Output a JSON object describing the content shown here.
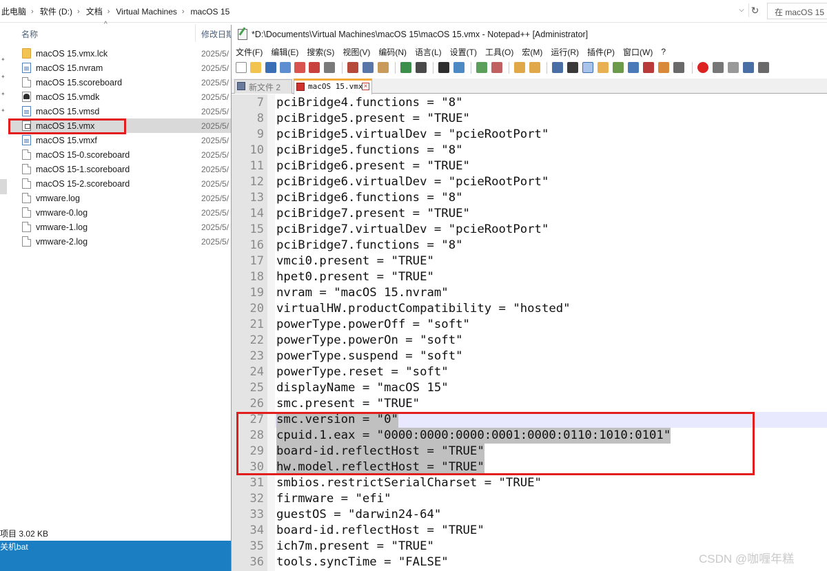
{
  "address_bar": {
    "breadcrumbs": [
      "此电脑",
      "软件 (D:)",
      "文档",
      "Virtual Machines",
      "macOS 15"
    ],
    "search_placeholder": "在 macOS 15"
  },
  "explorer": {
    "columns": {
      "name": "名称",
      "date": "修改日期"
    },
    "files": [
      {
        "name": "macOS 15.vmx.lck",
        "date": "2025/5/",
        "icon": "folder-icon"
      },
      {
        "name": "macOS 15.nvram",
        "date": "2025/5/",
        "icon": "document-blue-icon"
      },
      {
        "name": "macOS 15.scoreboard",
        "date": "2025/5/",
        "icon": "document-icon"
      },
      {
        "name": "macOS 15.vmdk",
        "date": "2025/5/",
        "icon": "disk-image-icon"
      },
      {
        "name": "macOS 15.vmsd",
        "date": "2025/5/",
        "icon": "document-blue-icon"
      },
      {
        "name": "macOS 15.vmx",
        "date": "2025/5/",
        "icon": "vm-config-icon",
        "selected": true
      },
      {
        "name": "macOS 15.vmxf",
        "date": "2025/5/",
        "icon": "document-blue-icon"
      },
      {
        "name": "macOS 15-0.scoreboard",
        "date": "2025/5/",
        "icon": "document-icon"
      },
      {
        "name": "macOS 15-1.scoreboard",
        "date": "2025/5/",
        "icon": "document-icon"
      },
      {
        "name": "macOS 15-2.scoreboard",
        "date": "2025/5/",
        "icon": "document-icon"
      },
      {
        "name": "vmware.log",
        "date": "2025/5/",
        "icon": "document-icon"
      },
      {
        "name": "vmware-0.log",
        "date": "2025/5/",
        "icon": "document-icon"
      },
      {
        "name": "vmware-1.log",
        "date": "2025/5/",
        "icon": "document-icon"
      },
      {
        "name": "vmware-2.log",
        "date": "2025/5/",
        "icon": "document-icon"
      }
    ],
    "status_text": "项目  3.02 KB",
    "taskbar_text": "关机bat"
  },
  "notepadpp": {
    "title": "*D:\\Documents\\Virtual Machines\\macOS 15\\macOS 15.vmx - Notepad++ [Administrator]",
    "menu": [
      "文件(F)",
      "编辑(E)",
      "搜索(S)",
      "视图(V)",
      "编码(N)",
      "语言(L)",
      "设置(T)",
      "工具(O)",
      "宏(M)",
      "运行(R)",
      "插件(P)",
      "窗口(W)",
      "?"
    ],
    "tabs": [
      {
        "label": "新文件 2",
        "active": false
      },
      {
        "label": "macOS 15.vmx",
        "active": true
      }
    ],
    "current_line": 27,
    "lines": [
      {
        "n": "7",
        "text": "pciBridge4.functions = \"8\""
      },
      {
        "n": "8",
        "text": "pciBridge5.present = \"TRUE\""
      },
      {
        "n": "9",
        "text": "pciBridge5.virtualDev = \"pcieRootPort\""
      },
      {
        "n": "10",
        "text": "pciBridge5.functions = \"8\""
      },
      {
        "n": "11",
        "text": "pciBridge6.present = \"TRUE\""
      },
      {
        "n": "12",
        "text": "pciBridge6.virtualDev = \"pcieRootPort\""
      },
      {
        "n": "13",
        "text": "pciBridge6.functions = \"8\""
      },
      {
        "n": "14",
        "text": "pciBridge7.present = \"TRUE\""
      },
      {
        "n": "15",
        "text": "pciBridge7.virtualDev = \"pcieRootPort\""
      },
      {
        "n": "16",
        "text": "pciBridge7.functions = \"8\""
      },
      {
        "n": "17",
        "text": "vmci0.present = \"TRUE\""
      },
      {
        "n": "18",
        "text": "hpet0.present = \"TRUE\""
      },
      {
        "n": "19",
        "text": "nvram = \"macOS 15.nvram\""
      },
      {
        "n": "20",
        "text": "virtualHW.productCompatibility = \"hosted\""
      },
      {
        "n": "21",
        "text": "powerType.powerOff = \"soft\""
      },
      {
        "n": "22",
        "text": "powerType.powerOn = \"soft\""
      },
      {
        "n": "23",
        "text": "powerType.suspend = \"soft\""
      },
      {
        "n": "24",
        "text": "powerType.reset = \"soft\""
      },
      {
        "n": "25",
        "text": "displayName = \"macOS 15\""
      },
      {
        "n": "26",
        "text": "smc.present = \"TRUE\""
      },
      {
        "n": "27",
        "text": "smc.version = \"0\"",
        "selected": true
      },
      {
        "n": "28",
        "text": "cpuid.1.eax = \"0000:0000:0000:0001:0000:0110:1010:0101\"",
        "selected": true
      },
      {
        "n": "29",
        "text": "board-id.reflectHost = \"TRUE\"",
        "selected": true
      },
      {
        "n": "30",
        "text": "hw.model.reflectHost = \"TRUE\"",
        "selected": true
      },
      {
        "n": "31",
        "text": "smbios.restrictSerialCharset = \"TRUE\""
      },
      {
        "n": "32",
        "text": "firmware = \"efi\""
      },
      {
        "n": "33",
        "text": "guestOS = \"darwin24-64\""
      },
      {
        "n": "34",
        "text": "board-id.reflectHost = \"TRUE\""
      },
      {
        "n": "35",
        "text": "ich7m.present = \"TRUE\""
      },
      {
        "n": "36",
        "text": "tools.syncTime = \"FALSE\""
      }
    ]
  },
  "watermark": "CSDN @咖喱年糕",
  "colors": {
    "highlight_box": "#e11d1d",
    "selection": "#c0c0c0",
    "current_line": "#e8e8ff",
    "active_tab_accent": "#f4a93b",
    "taskbar": "#1c7ec2"
  }
}
